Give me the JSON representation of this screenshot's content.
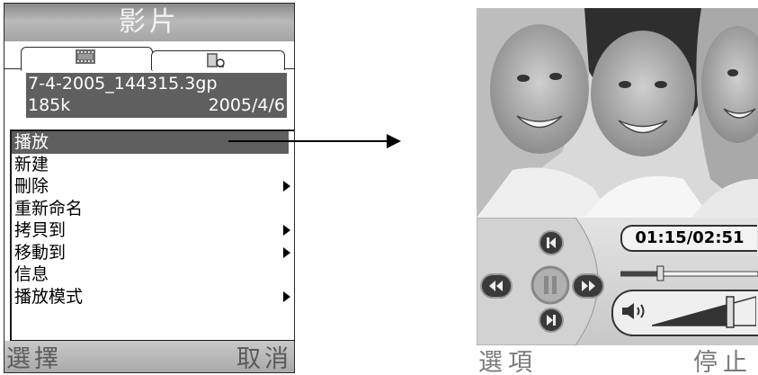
{
  "left_screen": {
    "title": "影片",
    "file_name": "7-4-2005_144315.3gp",
    "file_size": "185k",
    "file_date": "2005/4/6",
    "menu": [
      {
        "label": "播放",
        "submenu": false,
        "selected": true
      },
      {
        "label": "新建",
        "submenu": false,
        "selected": false
      },
      {
        "label": "刪除",
        "submenu": true,
        "selected": false
      },
      {
        "label": "重新命名",
        "submenu": false,
        "selected": false
      },
      {
        "label": "拷貝到",
        "submenu": true,
        "selected": false
      },
      {
        "label": "移動到",
        "submenu": true,
        "selected": false
      },
      {
        "label": "信息",
        "submenu": false,
        "selected": false
      },
      {
        "label": "播放模式",
        "submenu": true,
        "selected": false
      }
    ],
    "softkeys": {
      "left": "選擇",
      "right": "取消"
    }
  },
  "right_screen": {
    "time_display": "01:15/02:51",
    "progress_fraction": 0.29,
    "volume_fraction": 0.75,
    "softkeys": {
      "left": "選項",
      "right": "停止"
    }
  },
  "colors": {
    "selection": "#5f5f5f",
    "softkey_bg": "#b9b9b9"
  }
}
